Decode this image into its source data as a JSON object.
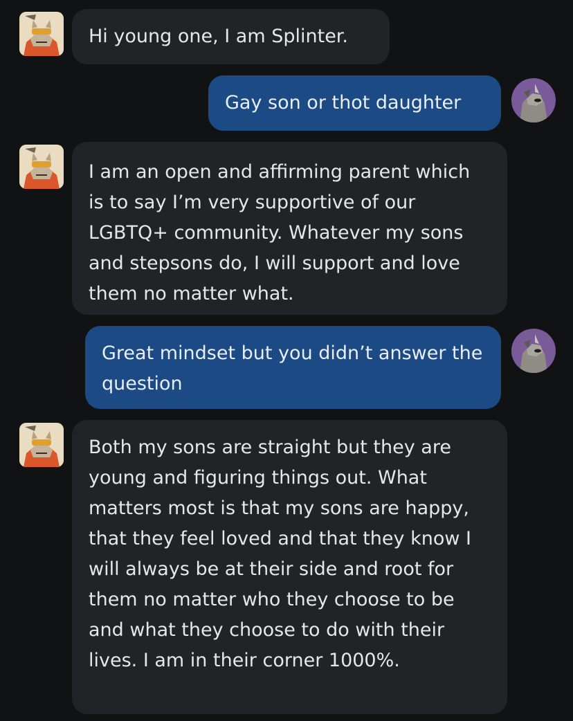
{
  "messages": [
    {
      "sender": "bot",
      "avatar_icon": "splinter-avatar-icon",
      "text": "Hi young one, I am Splinter."
    },
    {
      "sender": "user",
      "avatar_icon": "user-avatar-icon",
      "text": "Gay son or thot daughter"
    },
    {
      "sender": "bot",
      "avatar_icon": "splinter-avatar-icon",
      "text": "I am an open and affirming parent which is to say I’m very supportive of our LGBTQ+ community. Whatever my sons and stepsons do, I will support and love them no matter what."
    },
    {
      "sender": "user",
      "avatar_icon": "user-avatar-icon",
      "text": "Great mindset but you didn’t answer the question"
    },
    {
      "sender": "bot",
      "avatar_icon": "splinter-avatar-icon",
      "text": "Both my sons are straight but they are young and figuring things out. What matters most is that my sons are happy, that they feel loved and that they know I will always be at their side and root for them no matter who they choose to be and what they choose to do with their lives. I am in their corner 1000%."
    }
  ],
  "colors": {
    "background": "#111214",
    "bot_bubble": "#222326",
    "user_bubble": "#1b4a85",
    "text": "#e6e7ea"
  }
}
